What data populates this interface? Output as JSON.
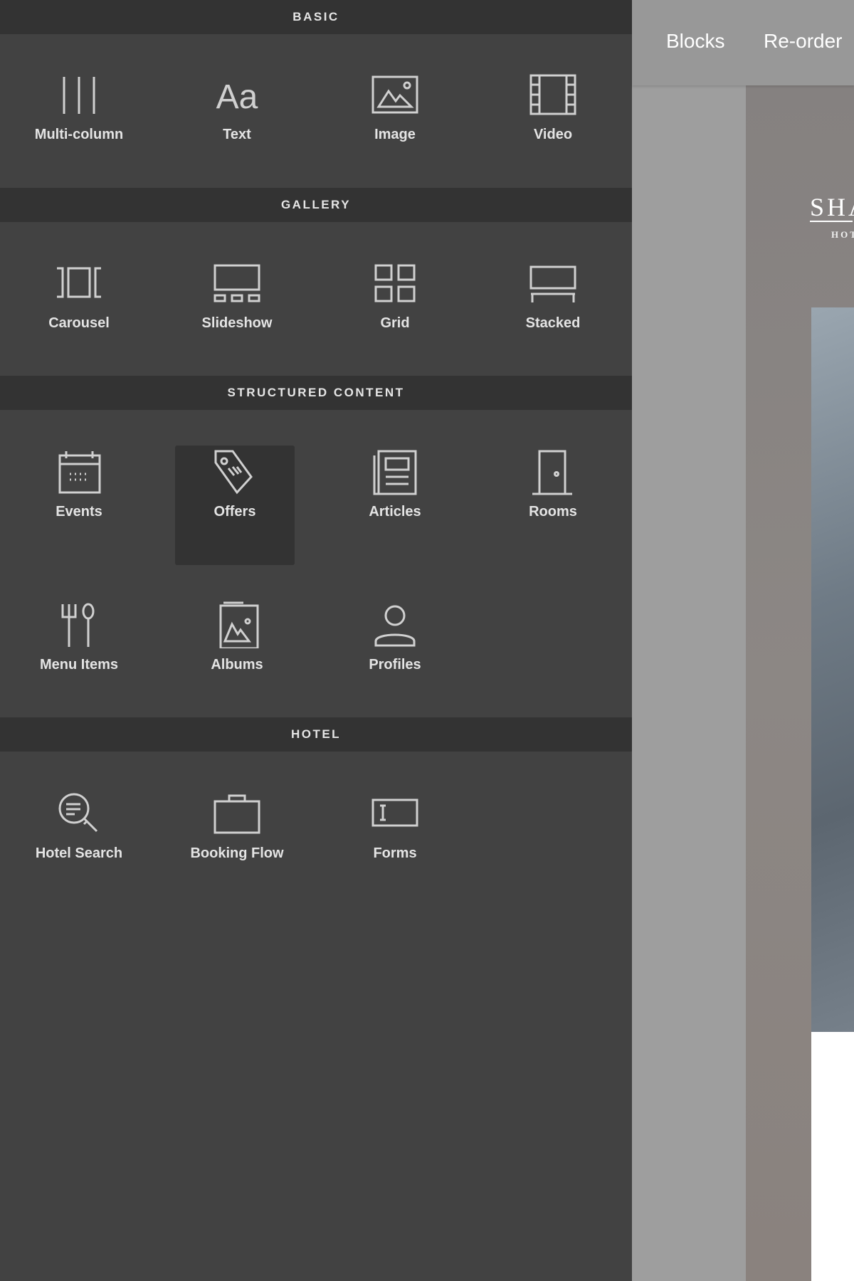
{
  "sections": [
    {
      "title": "BASIC",
      "items": [
        {
          "label": "Multi-column",
          "icon": "columns-icon"
        },
        {
          "label": "Text",
          "icon": "text-icon"
        },
        {
          "label": "Image",
          "icon": "image-icon"
        },
        {
          "label": "Video",
          "icon": "film-icon"
        }
      ]
    },
    {
      "title": "GALLERY",
      "items": [
        {
          "label": "Carousel",
          "icon": "carousel-icon"
        },
        {
          "label": "Slideshow",
          "icon": "slideshow-icon"
        },
        {
          "label": "Grid",
          "icon": "grid-icon"
        },
        {
          "label": "Stacked",
          "icon": "stacked-icon"
        }
      ]
    },
    {
      "title": "STRUCTURED CONTENT",
      "items": [
        {
          "label": "Events",
          "icon": "calendar-icon"
        },
        {
          "label": "Offers",
          "icon": "tag-icon",
          "selected": true
        },
        {
          "label": "Articles",
          "icon": "newspaper-icon"
        },
        {
          "label": "Rooms",
          "icon": "door-icon"
        },
        {
          "label": "Menu Items",
          "icon": "fork-spoon-icon"
        },
        {
          "label": "Albums",
          "icon": "album-icon"
        },
        {
          "label": "Profiles",
          "icon": "person-icon"
        }
      ]
    },
    {
      "title": "HOTEL",
      "items": [
        {
          "label": "Hotel Search",
          "icon": "search-list-icon"
        },
        {
          "label": "Booking Flow",
          "icon": "briefcase-icon"
        },
        {
          "label": "Forms",
          "icon": "form-field-icon"
        }
      ]
    }
  ],
  "topbar": {
    "tabs": [
      "Blocks",
      "Re-order"
    ]
  },
  "preview": {
    "logo": "SHA",
    "logo_sub": "HOT"
  }
}
